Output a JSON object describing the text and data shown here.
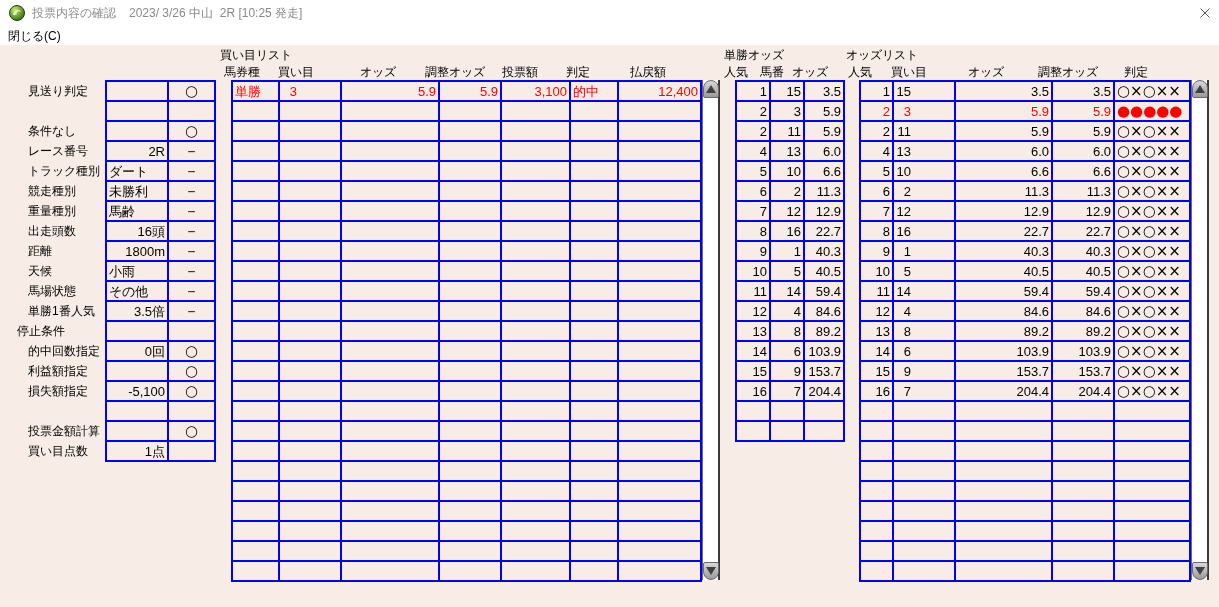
{
  "window": {
    "title": "投票内容の確認",
    "race_info": "2023/ 3/26 中山  2R [10:25 発走]"
  },
  "menu": [
    {
      "label": "閉じる(C)"
    }
  ],
  "conditions": {
    "rows": [
      {
        "kind": "item",
        "label": "見送り判定",
        "mark": "○"
      },
      {
        "kind": "blank"
      },
      {
        "kind": "item",
        "label": "条件なし",
        "mark": "○"
      },
      {
        "kind": "item",
        "label": "レース番号",
        "value": {
          "kind": "number",
          "text": "2R"
        },
        "mark": "－"
      },
      {
        "kind": "item",
        "label": "トラック種別",
        "value": {
          "kind": "text",
          "text": "ダート"
        },
        "mark": "－"
      },
      {
        "kind": "item",
        "label": "競走種別",
        "value": {
          "kind": "text",
          "text": "未勝利"
        },
        "mark": "－"
      },
      {
        "kind": "item",
        "label": "重量種別",
        "value": {
          "kind": "text",
          "text": "馬齢"
        },
        "mark": "－"
      },
      {
        "kind": "item",
        "label": "出走頭数",
        "value": {
          "kind": "number",
          "text": "16頭"
        },
        "mark": "－"
      },
      {
        "kind": "item",
        "label": "距離",
        "value": {
          "kind": "number",
          "text": "1800m"
        },
        "mark": "－"
      },
      {
        "kind": "item",
        "label": "天候",
        "value": {
          "kind": "text",
          "text": "小雨"
        },
        "mark": "－"
      },
      {
        "kind": "item",
        "label": "馬場状態",
        "value": {
          "kind": "text",
          "text": "その他"
        },
        "mark": "－"
      },
      {
        "kind": "item",
        "label": "単勝1番人気",
        "value": {
          "kind": "number",
          "text": "3.5倍"
        },
        "mark": "－"
      },
      {
        "kind": "section",
        "label": "停止条件"
      },
      {
        "kind": "item",
        "label": "的中回数指定",
        "value": {
          "kind": "number",
          "text": "0回"
        },
        "mark": "○"
      },
      {
        "kind": "item",
        "label": "利益額指定",
        "mark": "○"
      },
      {
        "kind": "item",
        "label": "損失額指定",
        "value": {
          "kind": "number",
          "text": "-5,100"
        },
        "mark": "○"
      },
      {
        "kind": "blank"
      },
      {
        "kind": "item",
        "label": "投票金額計算",
        "mark": "○"
      },
      {
        "kind": "item",
        "label": "買い目点数",
        "value": {
          "kind": "number",
          "text": "1点"
        }
      }
    ]
  },
  "buy_list": {
    "title": "買い目リスト",
    "columns": [
      "馬券種",
      "買い目",
      "オッズ",
      "調整オッズ",
      "投票額",
      "判定",
      "払戻額"
    ],
    "rows": [
      {
        "cells": [
          "単勝",
          "3",
          "5.9",
          "5.9",
          "3,100",
          "的中",
          "12,400"
        ],
        "highlighted": true
      }
    ]
  },
  "win_odds": {
    "title": "単勝オッズ",
    "columns": [
      "人気",
      "馬番",
      "オッズ"
    ],
    "rows": [
      [
        "1",
        "15",
        "3.5"
      ],
      [
        "2",
        "3",
        "5.9"
      ],
      [
        "2",
        "11",
        "5.9"
      ],
      [
        "4",
        "13",
        "6.0"
      ],
      [
        "5",
        "10",
        "6.6"
      ],
      [
        "6",
        "2",
        "11.3"
      ],
      [
        "7",
        "12",
        "12.9"
      ],
      [
        "8",
        "16",
        "22.7"
      ],
      [
        "9",
        "1",
        "40.3"
      ],
      [
        "10",
        "5",
        "40.5"
      ],
      [
        "11",
        "14",
        "59.4"
      ],
      [
        "12",
        "4",
        "84.6"
      ],
      [
        "13",
        "8",
        "89.2"
      ],
      [
        "14",
        "6",
        "103.9"
      ],
      [
        "15",
        "9",
        "153.7"
      ],
      [
        "16",
        "7",
        "204.4"
      ]
    ]
  },
  "odds_list": {
    "title": "オッズリスト",
    "columns": [
      "人気",
      "買い目",
      "オッズ",
      "調整オッズ",
      "判定"
    ],
    "rows": [
      {
        "cells": [
          "1",
          "15",
          "3.5",
          "3.5",
          "○×○××"
        ],
        "highlighted": false
      },
      {
        "cells": [
          "2",
          "3",
          "5.9",
          "5.9",
          "●●●●●"
        ],
        "highlighted": true
      },
      {
        "cells": [
          "2",
          "11",
          "5.9",
          "5.9",
          "○×○××"
        ],
        "highlighted": false
      },
      {
        "cells": [
          "4",
          "13",
          "6.0",
          "6.0",
          "○×○××"
        ],
        "highlighted": false
      },
      {
        "cells": [
          "5",
          "10",
          "6.6",
          "6.6",
          "○×○××"
        ],
        "highlighted": false
      },
      {
        "cells": [
          "6",
          "2",
          "11.3",
          "11.3",
          "○×○××"
        ],
        "highlighted": false
      },
      {
        "cells": [
          "7",
          "12",
          "12.9",
          "12.9",
          "○×○××"
        ],
        "highlighted": false
      },
      {
        "cells": [
          "8",
          "16",
          "22.7",
          "22.7",
          "○×○××"
        ],
        "highlighted": false
      },
      {
        "cells": [
          "9",
          "1",
          "40.3",
          "40.3",
          "○×○××"
        ],
        "highlighted": false
      },
      {
        "cells": [
          "10",
          "5",
          "40.5",
          "40.5",
          "○×○××"
        ],
        "highlighted": false
      },
      {
        "cells": [
          "11",
          "14",
          "59.4",
          "59.4",
          "○×○××"
        ],
        "highlighted": false
      },
      {
        "cells": [
          "12",
          "4",
          "84.6",
          "84.6",
          "○×○××"
        ],
        "highlighted": false
      },
      {
        "cells": [
          "13",
          "8",
          "89.2",
          "89.2",
          "○×○××"
        ],
        "highlighted": false
      },
      {
        "cells": [
          "14",
          "6",
          "103.9",
          "103.9",
          "○×○××"
        ],
        "highlighted": false
      },
      {
        "cells": [
          "15",
          "9",
          "153.7",
          "153.7",
          "○×○××"
        ],
        "highlighted": false
      },
      {
        "cells": [
          "16",
          "7",
          "204.4",
          "204.4",
          "○×○××"
        ],
        "highlighted": false
      }
    ]
  }
}
